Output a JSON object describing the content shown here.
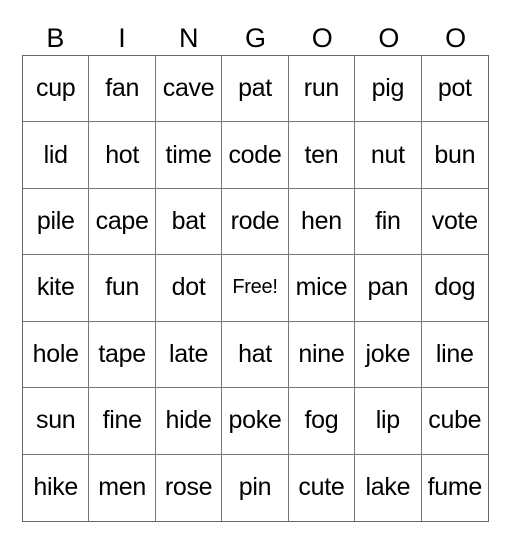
{
  "header": [
    "B",
    "I",
    "N",
    "G",
    "O",
    "O",
    "O"
  ],
  "cells": [
    [
      "cup",
      "fan",
      "cave",
      "pat",
      "run",
      "pig",
      "pot"
    ],
    [
      "lid",
      "hot",
      "time",
      "code",
      "ten",
      "nut",
      "bun"
    ],
    [
      "pile",
      "cape",
      "bat",
      "rode",
      "hen",
      "fin",
      "vote"
    ],
    [
      "kite",
      "fun",
      "dot",
      "Free!",
      "mice",
      "pan",
      "dog"
    ],
    [
      "hole",
      "tape",
      "late",
      "hat",
      "nine",
      "joke",
      "line"
    ],
    [
      "sun",
      "fine",
      "hide",
      "poke",
      "fog",
      "lip",
      "cube"
    ],
    [
      "hike",
      "men",
      "rose",
      "pin",
      "cute",
      "lake",
      "fume"
    ]
  ]
}
